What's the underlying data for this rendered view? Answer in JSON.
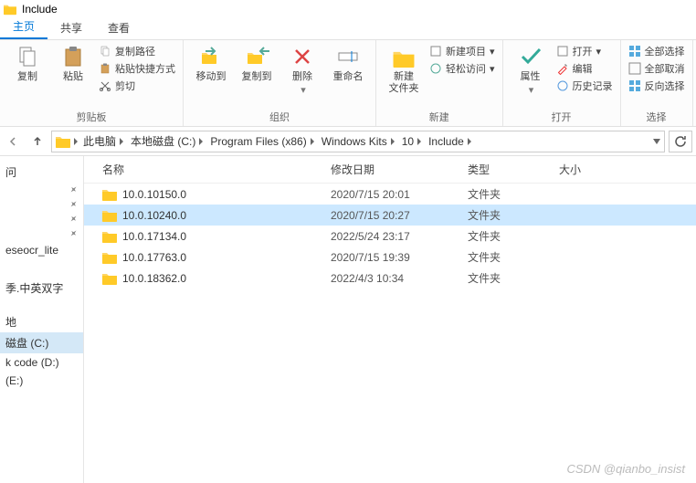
{
  "title": "Include",
  "tabs": {
    "home": "主页",
    "share": "共享",
    "view": "查看"
  },
  "ribbon": {
    "clip": {
      "label": "剪贴板",
      "copy": "复制",
      "paste": "粘贴",
      "copy_path": "复制路径",
      "paste_shortcut": "粘贴快捷方式",
      "cut": "剪切"
    },
    "org": {
      "label": "组织",
      "move": "移动到",
      "copyto": "复制到",
      "delete": "删除",
      "rename": "重命名"
    },
    "new": {
      "label": "新建",
      "folder": "新建\n文件夹",
      "newitem": "新建项目",
      "easy": "轻松访问"
    },
    "open": {
      "label": "打开",
      "props": "属性",
      "open": "打开",
      "edit": "编辑",
      "history": "历史记录"
    },
    "select": {
      "label": "选择",
      "all": "全部选择",
      "none": "全部取消",
      "invert": "反向选择"
    }
  },
  "breadcrumbs": [
    "此电脑",
    "本地磁盘 (C:)",
    "Program Files (x86)",
    "Windows Kits",
    "10",
    "Include"
  ],
  "columns": {
    "name": "名称",
    "date": "修改日期",
    "type": "类型",
    "size": "大小"
  },
  "rows": [
    {
      "name": "10.0.10150.0",
      "date": "2020/7/15 20:01",
      "type": "文件夹",
      "sel": false
    },
    {
      "name": "10.0.10240.0",
      "date": "2020/7/15 20:27",
      "type": "文件夹",
      "sel": true
    },
    {
      "name": "10.0.17134.0",
      "date": "2022/5/24 23:17",
      "type": "文件夹",
      "sel": false
    },
    {
      "name": "10.0.17763.0",
      "date": "2020/7/15 19:39",
      "type": "文件夹",
      "sel": false
    },
    {
      "name": "10.0.18362.0",
      "date": "2022/4/3 10:34",
      "type": "文件夹",
      "sel": false
    }
  ],
  "sidebar": {
    "quick": "问",
    "ocr": "eseocr_lite",
    "movie": "季.中英双字",
    "disk_c": "磁盘 (C:)",
    "disk_d": "k code (D:)",
    "disk_e": "(E:)",
    "bd_item": "地"
  },
  "watermark": "CSDN @qianbo_insist"
}
